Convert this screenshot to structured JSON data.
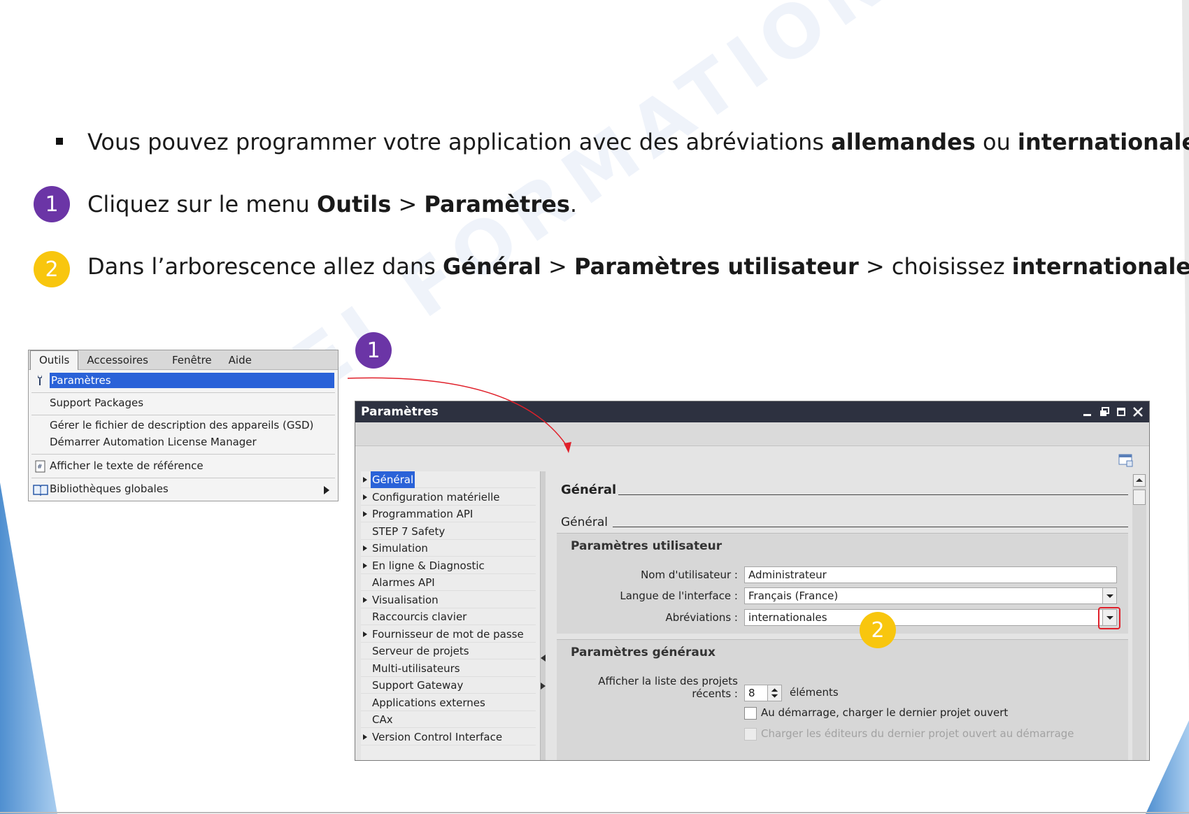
{
  "slide": {
    "bullet_intro": {
      "text_before": "Vous pouvez programmer votre application avec des abréviations ",
      "bold1": "allemandes",
      "mid": " ou ",
      "bold2": "internationales",
      "end": "."
    },
    "step1": {
      "number": "1",
      "text_before": "Cliquez sur le menu ",
      "bold1": "Outils",
      "sep": " > ",
      "bold2": "Paramètres",
      "end": "."
    },
    "step2": {
      "number": "2",
      "text_before": "Dans l’arborescence allez dans ",
      "bold1": "Général",
      "sep1": " > ",
      "bold2": "Paramètres utilisateur",
      "sep2": " > choisissez ",
      "bold3": "internationales",
      "end": "."
    },
    "watermark": "AEI FORMATION OUEST",
    "callout1": "1",
    "callout2": "2"
  },
  "menu": {
    "bar": [
      "Outils",
      "Accessoires",
      "Fenêtre",
      "Aide"
    ],
    "items": {
      "parametres": "Paramètres",
      "support_packages": "Support Packages",
      "gsd": "Gérer le fichier de description des appareils (GSD)",
      "alm": "Démarrer Automation License Manager",
      "ref_text": "Afficher le texte de référence",
      "libraries": "Bibliothèques globales"
    }
  },
  "window": {
    "title": "Paramètres",
    "tree": [
      {
        "label": "Général",
        "expandable": true,
        "selected": true
      },
      {
        "label": "Configuration matérielle",
        "expandable": true
      },
      {
        "label": "Programmation API",
        "expandable": true
      },
      {
        "label": "STEP 7 Safety",
        "expandable": false
      },
      {
        "label": "Simulation",
        "expandable": true
      },
      {
        "label": "En ligne & Diagnostic",
        "expandable": true
      },
      {
        "label": "Alarmes API",
        "expandable": false
      },
      {
        "label": "Visualisation",
        "expandable": true
      },
      {
        "label": "Raccourcis clavier",
        "expandable": false
      },
      {
        "label": "Fournisseur de mot de passe",
        "expandable": true
      },
      {
        "label": "Serveur de projets",
        "expandable": false
      },
      {
        "label": "Multi-utilisateurs",
        "expandable": false
      },
      {
        "label": "Support Gateway",
        "expandable": false
      },
      {
        "label": "Applications externes",
        "expandable": false
      },
      {
        "label": "CAx",
        "expandable": false
      },
      {
        "label": "Version Control Interface",
        "expandable": true
      }
    ],
    "section_title": "Général",
    "subsection_title": "Général",
    "user_panel": {
      "title": "Paramètres utilisateur",
      "username_label": "Nom d'utilisateur :",
      "username_value": "Administrateur",
      "language_label": "Langue de l'interface :",
      "language_value": "Français (France)",
      "abbr_label": "Abréviations :",
      "abbr_value": "internationales"
    },
    "general_panel": {
      "title": "Paramètres généraux",
      "recent_label_1": "Afficher la liste des projets",
      "recent_label_2": "récents :",
      "recent_value": "8",
      "recent_unit": "éléments",
      "load_last": "Au démarrage, charger le dernier projet ouvert",
      "load_editors": "Charger les éditeurs du dernier projet ouvert au démarrage"
    }
  },
  "colors": {
    "purple": "#6b35a6",
    "yellow": "#f8c60e",
    "selection": "#2a62d8",
    "highlight": "#e0202a",
    "corner": "#5b9bd5"
  }
}
